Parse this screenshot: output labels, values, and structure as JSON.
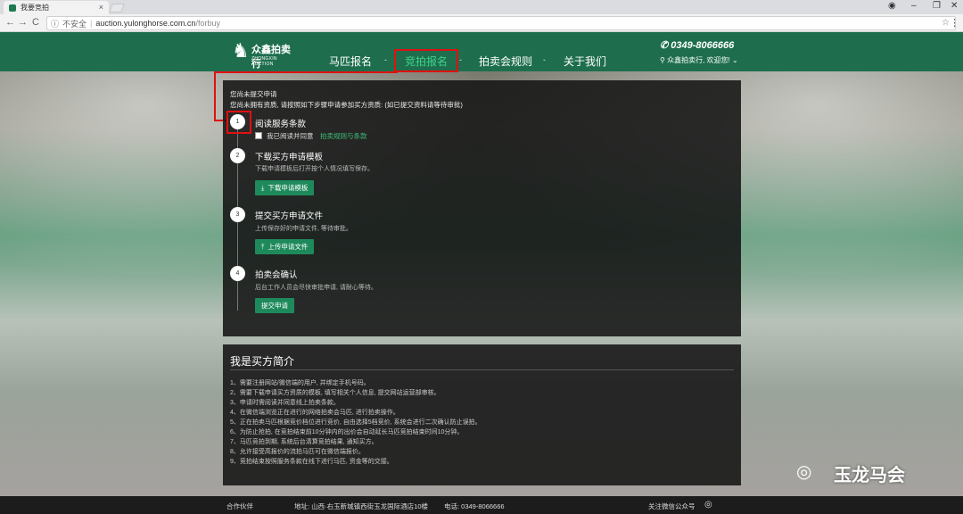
{
  "browser": {
    "tab_title": "我要竞拍",
    "tab_close": "×",
    "security_label": "不安全",
    "url_domain": "auction.yulonghorse.com.cn",
    "url_path": "/forbuy",
    "back": "←",
    "forward": "→",
    "reload": "C",
    "star": "☆",
    "menu": "⋮",
    "minimize": "–",
    "maximize": "❐",
    "close": "✕",
    "account": "◉"
  },
  "header": {
    "logo_name": "众鑫拍卖行",
    "logo_sub": "ZHONGXIN AUCTION",
    "nav": [
      "马匹报名",
      "竞拍报名",
      "拍卖会规则",
      "关于我们"
    ],
    "nav_separator": "-",
    "phone": "0349-8066666",
    "phone_icon": "✆",
    "welcome": "众鑫拍卖行, 欢迎您! ⌄",
    "welcome_icon": "⚲",
    "active_nav_index": 1,
    "accent_color": "#1e6e4e",
    "highlight_color": "#e01010"
  },
  "apply": {
    "notice_title": "您尚未提交申请",
    "notice_desc": "您尚未拥有资质, 请按照如下步骤申请参加买方资质: (如已提交资料请等待审批)",
    "steps": [
      {
        "num": "1",
        "title": "阅读服务条款",
        "checkbox_label": "我已阅读并同意",
        "link": "拍卖规则与条款"
      },
      {
        "num": "2",
        "title": "下载买方申请模板",
        "desc": "下载申请模板后打开按个人情况填写保存。",
        "button": "下载申请模板",
        "button_icon": "⤓"
      },
      {
        "num": "3",
        "title": "提交买方申请文件",
        "desc": "上传保存好的申请文件, 等待审批。",
        "button": "上传申请文件",
        "button_icon": "⤒"
      },
      {
        "num": "4",
        "title": "拍卖会确认",
        "desc": "后台工作人员会尽快审批申请, 请耐心等待。",
        "button": "提交申请"
      }
    ]
  },
  "intro": {
    "title": "我是买方简介",
    "rules": [
      "1、需要注册网站/微信端的用户, 并绑定手机号码。",
      "2、需要下载申请买方资质的模板, 填写相关个人信息, 提交网站运营部审核。",
      "3、申请时需阅读并同意线上拍卖条款。",
      "4、在微信端浏览正在进行的网络拍卖会马匹, 进行拍卖操作。",
      "5、正在拍卖马匹根据竞价档位进行竞价, 自由选择5档竞价, 系统会进行二次确认防止误拍。",
      "6、为防止抢拍, 在竞拍结束前10分钟内的出价会自动延长马匹竞拍结束时间10分钟。",
      "7、马匹竞拍到期, 系统后台清算竞拍结果, 通知买方。",
      "8、允许接受高报价的流拍马匹可在微信端报价。",
      "9、竞拍结束按照服务条款在线下进行马匹, 资金等的交接。"
    ]
  },
  "footer": {
    "partner": "合作伙伴",
    "address": "地址: 山西·右玉新城镇西街玉龙国际酒店10楼",
    "phone": "电话: 0349-8066666",
    "wechat": "关注微信公众号",
    "wechat_icon": "◎"
  },
  "watermark": {
    "icon": "◎",
    "text": "玉龙马会"
  }
}
